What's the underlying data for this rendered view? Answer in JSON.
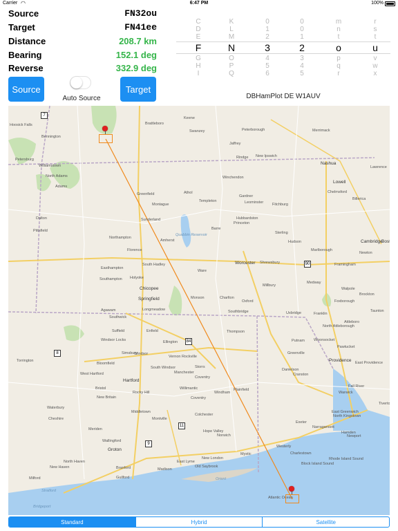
{
  "status": {
    "carrier": "Carrier",
    "time": "6:47 PM",
    "battery": "100%"
  },
  "info": {
    "source_label": "Source",
    "source_value": "FN32ou",
    "target_label": "Target",
    "target_value": "FN41ee",
    "distance_label": "Distance",
    "distance_value": "208.7 km",
    "bearing_label": "Bearing",
    "bearing_value": "152.1 deg",
    "reverse_label": "Reverse",
    "reverse_value": "332.9 deg",
    "value_color": "#35b54a"
  },
  "buttons": {
    "source": "Source",
    "target": "Target",
    "toggle_label": "Auto Source",
    "toggle_on": false
  },
  "picker": {
    "columns": [
      {
        "above": [
          "C",
          "D",
          "E"
        ],
        "selected": "F",
        "below": [
          "G",
          "H",
          "I"
        ]
      },
      {
        "above": [
          "K",
          "L",
          "M"
        ],
        "selected": "N",
        "below": [
          "O",
          "P",
          "Q"
        ]
      },
      {
        "above": [
          "0",
          "1",
          "2"
        ],
        "selected": "3",
        "below": [
          "4",
          "5",
          "6"
        ]
      },
      {
        "above": [
          "0",
          "0",
          "1"
        ],
        "selected": "2",
        "below": [
          "3",
          "4",
          "5"
        ]
      },
      {
        "above": [
          "m",
          "n",
          "t"
        ],
        "selected": "o",
        "below": [
          "p",
          "q",
          "r"
        ]
      },
      {
        "above": [
          "r",
          "s",
          "t"
        ],
        "selected": "u",
        "below": [
          "v",
          "w",
          "x"
        ]
      }
    ]
  },
  "credit": "DBHamPlot DE W1AUV",
  "map": {
    "places": [
      {
        "name": "Keene"
      },
      {
        "name": "Peterborough"
      },
      {
        "name": "Merrimack"
      },
      {
        "name": "Nashua"
      },
      {
        "name": "Swanzey"
      },
      {
        "name": "Jaffrey"
      },
      {
        "name": "Rindge"
      },
      {
        "name": "New Ipswich"
      },
      {
        "name": "Brattleboro"
      },
      {
        "name": "Bennington"
      },
      {
        "name": "Hoosick Falls"
      },
      {
        "name": "Petersburg"
      },
      {
        "name": "Williamstown"
      },
      {
        "name": "North Adams"
      },
      {
        "name": "Adams"
      },
      {
        "name": "Lowell"
      },
      {
        "name": "Lawrence"
      },
      {
        "name": "Chelmsford"
      },
      {
        "name": "Billerica"
      },
      {
        "name": "Winchendon"
      },
      {
        "name": "Gardner"
      },
      {
        "name": "Fitchburg"
      },
      {
        "name": "Greenfield"
      },
      {
        "name": "Athol"
      },
      {
        "name": "Templeton"
      },
      {
        "name": "Leominster"
      },
      {
        "name": "Montague"
      },
      {
        "name": "Hubbardston"
      },
      {
        "name": "Princeton"
      },
      {
        "name": "Sunderland"
      },
      {
        "name": "Quabbin Reservoir"
      },
      {
        "name": "Dalton"
      },
      {
        "name": "Pittsfield"
      },
      {
        "name": "Amherst"
      },
      {
        "name": "Barre"
      },
      {
        "name": "Sterling"
      },
      {
        "name": "Hudson"
      },
      {
        "name": "Marlborough"
      },
      {
        "name": "Cambridge"
      },
      {
        "name": "Boston"
      },
      {
        "name": "Northampton"
      },
      {
        "name": "Florence"
      },
      {
        "name": "Easthampton"
      },
      {
        "name": "South Hadley"
      },
      {
        "name": "Southampton"
      },
      {
        "name": "Holyoke"
      },
      {
        "name": "Worcester"
      },
      {
        "name": "Shrewsbury"
      },
      {
        "name": "Framingham"
      },
      {
        "name": "Newton"
      },
      {
        "name": "Ware"
      },
      {
        "name": "Chicopee"
      },
      {
        "name": "Springfield"
      },
      {
        "name": "Monson"
      },
      {
        "name": "Charlton"
      },
      {
        "name": "Oxford"
      },
      {
        "name": "Millbury"
      },
      {
        "name": "Medway"
      },
      {
        "name": "Walpole"
      },
      {
        "name": "Brockton"
      },
      {
        "name": "Agawam"
      },
      {
        "name": "Longmeadow"
      },
      {
        "name": "Southwick"
      },
      {
        "name": "Southbridge"
      },
      {
        "name": "Uxbridge"
      },
      {
        "name": "Franklin"
      },
      {
        "name": "Foxborough"
      },
      {
        "name": "Taunton"
      },
      {
        "name": "Suffield"
      },
      {
        "name": "Enfield"
      },
      {
        "name": "Windsor Locks"
      },
      {
        "name": "Ellington"
      },
      {
        "name": "Thompson"
      },
      {
        "name": "North Attleborough"
      },
      {
        "name": "Attleboro"
      },
      {
        "name": "Torrington"
      },
      {
        "name": "Simsbury"
      },
      {
        "name": "Windsor"
      },
      {
        "name": "Vernon Rockville"
      },
      {
        "name": "Putnam"
      },
      {
        "name": "Woonsocket"
      },
      {
        "name": "Greenville"
      },
      {
        "name": "Pawtucket"
      },
      {
        "name": "Bloomfield"
      },
      {
        "name": "South Windsor"
      },
      {
        "name": "Storrs"
      },
      {
        "name": "Danielson"
      },
      {
        "name": "Providence"
      },
      {
        "name": "East Providence"
      },
      {
        "name": "Fall River"
      },
      {
        "name": "West Hartford"
      },
      {
        "name": "Hartford"
      },
      {
        "name": "Manchester"
      },
      {
        "name": "Coventry"
      },
      {
        "name": "Cranston"
      },
      {
        "name": "Warwick"
      },
      {
        "name": "Bristol"
      },
      {
        "name": "New Britain"
      },
      {
        "name": "Rocky Hill"
      },
      {
        "name": "Willimantic"
      },
      {
        "name": "Windham"
      },
      {
        "name": "Plainfield"
      },
      {
        "name": "Coventry"
      },
      {
        "name": "East Greenwich"
      },
      {
        "name": "Tiverton"
      },
      {
        "name": "Waterbury"
      },
      {
        "name": "Meriden"
      },
      {
        "name": "Middletown"
      },
      {
        "name": "Colchester"
      },
      {
        "name": "Norwich"
      },
      {
        "name": "Exeter"
      },
      {
        "name": "North Kingstown"
      },
      {
        "name": "Newport"
      },
      {
        "name": "Cheshire"
      },
      {
        "name": "Wallingford"
      },
      {
        "name": "Montville"
      },
      {
        "name": "Hope Valley"
      },
      {
        "name": "Narragansett"
      },
      {
        "name": "Hamden"
      },
      {
        "name": "North Haven"
      },
      {
        "name": "Groton"
      },
      {
        "name": "New London"
      },
      {
        "name": "Mystic"
      },
      {
        "name": "Westerly"
      },
      {
        "name": "Charlestown"
      },
      {
        "name": "New Haven"
      },
      {
        "name": "Branford"
      },
      {
        "name": "Guilford"
      },
      {
        "name": "Madison"
      },
      {
        "name": "Old Saybrook"
      },
      {
        "name": "East Lyme"
      },
      {
        "name": "Milford"
      },
      {
        "name": "Stratford"
      },
      {
        "name": "Bridgeport"
      },
      {
        "name": "Orient"
      },
      {
        "name": "Block Island Sound"
      },
      {
        "name": "Rhode Island Sound"
      },
      {
        "name": "Atlantic Ocean"
      }
    ],
    "shields": [
      "7",
      "8",
      "9",
      "11",
      "84",
      "90"
    ],
    "segments": [
      "Standard",
      "Hybrid",
      "Satellite"
    ],
    "active_segment": "Standard",
    "route_color": "#f08a1d"
  }
}
